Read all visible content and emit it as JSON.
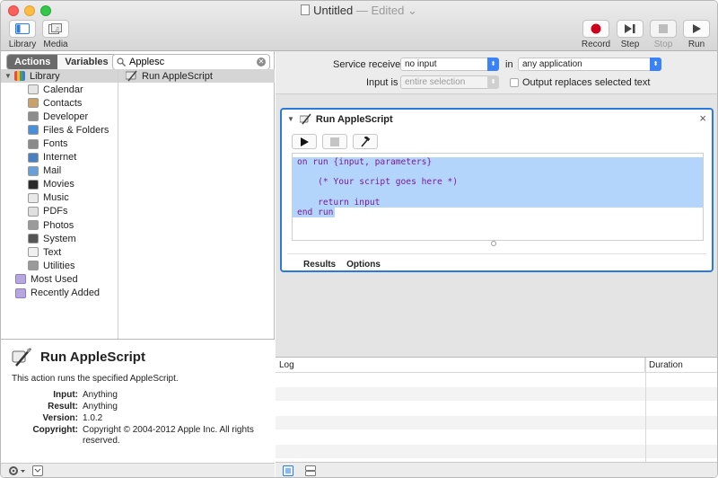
{
  "window": {
    "title": "Untitled",
    "edited": "— Edited ⌄"
  },
  "toolbar": {
    "library_label": "Library",
    "media_label": "Media",
    "record_label": "Record",
    "step_label": "Step",
    "stop_label": "Stop",
    "run_label": "Run",
    "record_color": "#d0021b"
  },
  "library": {
    "tab_actions": "Actions",
    "tab_variables": "Variables",
    "search_value": "Applesc",
    "root": "Library",
    "categories": [
      "Calendar",
      "Contacts",
      "Developer",
      "Files & Folders",
      "Fonts",
      "Internet",
      "Mail",
      "Movies",
      "Music",
      "PDFs",
      "Photos",
      "System",
      "Text",
      "Utilities"
    ],
    "category_icons": [
      "calendar-icon",
      "contacts-icon",
      "developer-icon",
      "files-folders-icon",
      "fonts-icon",
      "internet-icon",
      "mail-icon",
      "movies-icon",
      "music-icon",
      "pdfs-icon",
      "photos-icon",
      "system-icon",
      "text-icon",
      "utilities-icon"
    ],
    "smart_groups": [
      "Most Used",
      "Recently Added"
    ],
    "actions": [
      "Run AppleScript"
    ]
  },
  "description": {
    "title": "Run AppleScript",
    "summary": "This action runs the specified AppleScript.",
    "input_key": "Input:",
    "input_value": "Anything",
    "result_key": "Result:",
    "result_value": "Anything",
    "version_key": "Version:",
    "version_value": "1.0.2",
    "copyright_key": "Copyright:",
    "copyright_value": "Copyright © 2004-2012 Apple Inc.  All rights reserved."
  },
  "workflow": {
    "service_receives_label": "Service receives",
    "service_receives_value": "no input",
    "in_label": "in",
    "application_value": "any application",
    "input_is_label": "Input is",
    "input_is_value": "entire selection",
    "output_replaces_label": "Output replaces selected text"
  },
  "action_card": {
    "title": "Run AppleScript",
    "code_lines": [
      "on run {input, parameters}",
      "",
      "    (* Your script goes here *)",
      "",
      "    return input",
      "end run"
    ],
    "results_tab": "Results",
    "options_tab": "Options"
  },
  "log": {
    "col_log": "Log",
    "col_duration": "Duration"
  }
}
